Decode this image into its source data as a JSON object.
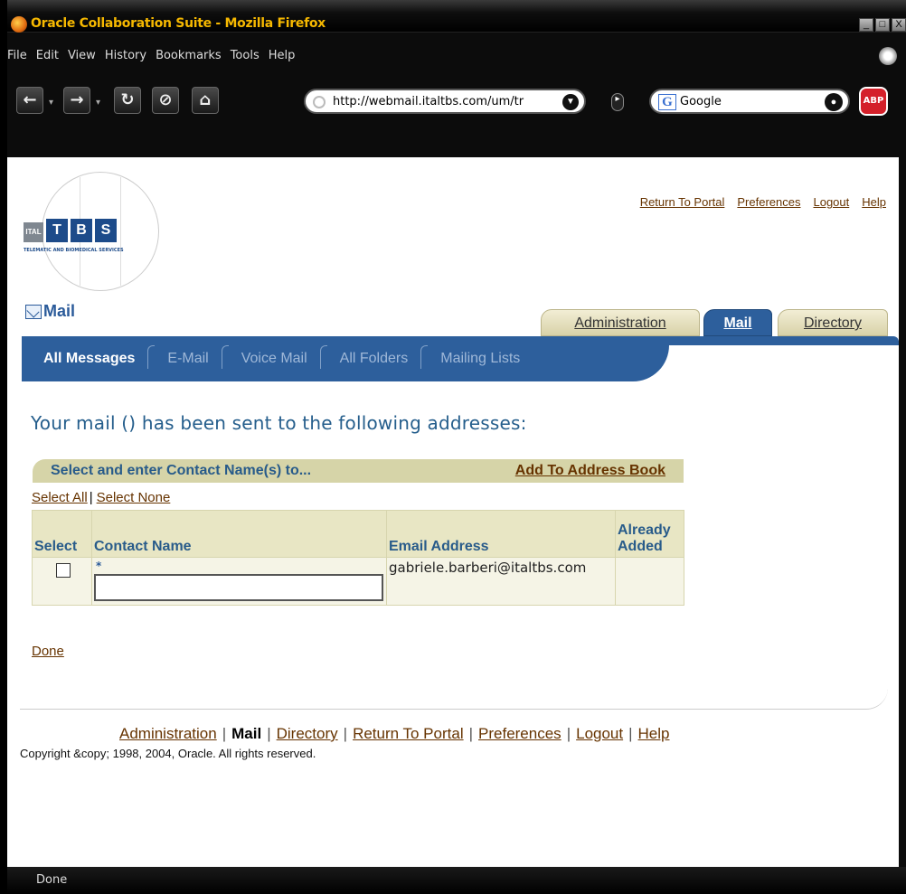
{
  "window": {
    "title": "Oracle Collaboration Suite - Mozilla Firefox",
    "controls": [
      "_",
      "□",
      "X"
    ]
  },
  "menu": [
    "File",
    "Edit",
    "View",
    "History",
    "Bookmarks",
    "Tools",
    "Help"
  ],
  "toolbar": {
    "url": "http://webmail.italtbs.com/um/tr",
    "search_engine_letter": "G",
    "search_text": "Google",
    "adblock_label": "ABP",
    "icons": [
      "back-arrow-icon",
      "forward-arrow-icon",
      "reload-icon",
      "stop-icon",
      "home-icon",
      "globe-icon",
      "go-icon",
      "rss-icon",
      "magnifier-icon"
    ]
  },
  "logo": {
    "blocks": [
      "ITAL",
      "T",
      "B",
      "S"
    ],
    "tagline": "TELEMATIC AND BIOMEDICAL SERVICES"
  },
  "global_links": [
    "Return To Portal",
    "Preferences",
    "Logout",
    "Help"
  ],
  "app_title": "Mail",
  "tabs": [
    {
      "label": "Administration",
      "active": false
    },
    {
      "label": "Mail",
      "active": true
    },
    {
      "label": "Directory",
      "active": false
    }
  ],
  "subnav": [
    "All Messages",
    "E-Mail",
    "Voice Mail",
    "All Folders",
    "Mailing Lists"
  ],
  "confirmation_heading": "Your mail () has been sent to the following addresses:",
  "address_table": {
    "title": "Select and enter Contact Name(s) to...",
    "add_button": "Add To Address Book",
    "select_all": "Select All",
    "select_none": "Select None",
    "columns": [
      "Select",
      "Contact Name",
      "Email Address",
      "Already Added"
    ],
    "rows": [
      {
        "checked": false,
        "required_marker": "*",
        "contact_name": "",
        "email": "gabriele.barberi@italtbs.com",
        "already_added": ""
      }
    ]
  },
  "done_label": "Done",
  "footer": {
    "links": [
      "Administration",
      "Mail",
      "Directory",
      "Return To Portal",
      "Preferences",
      "Logout",
      "Help"
    ],
    "separator": "|",
    "copyright": "Copyright &copy; 1998, 2004, Oracle. All rights reserved."
  },
  "status_bar": "Done",
  "colors": {
    "brand_blue": "#2d5f9c",
    "tab_tan": "#d8d2a8",
    "link_brown": "#663300",
    "heading_blue": "#255e8c",
    "title_gold": "#f6b800"
  }
}
